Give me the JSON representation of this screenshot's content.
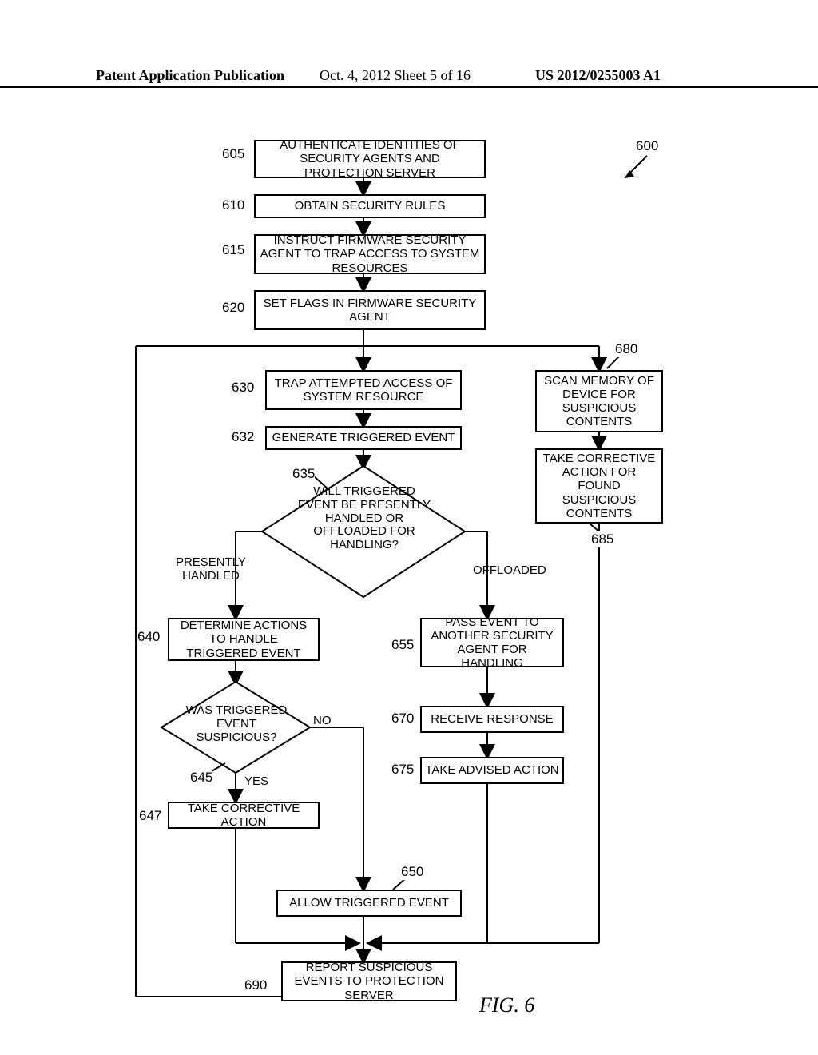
{
  "header": {
    "left": "Patent Application Publication",
    "mid": "Oct. 4, 2012   Sheet 5 of 16",
    "right": "US 2012/0255003 A1"
  },
  "refs": {
    "r600": "600",
    "r605": "605",
    "r610": "610",
    "r615": "615",
    "r620": "620",
    "r630": "630",
    "r632": "632",
    "r635": "635",
    "r640": "640",
    "r645": "645",
    "r647": "647",
    "r650": "650",
    "r655": "655",
    "r670": "670",
    "r675": "675",
    "r680": "680",
    "r685": "685",
    "r690": "690"
  },
  "boxes": {
    "b605": "AUTHENTICATE IDENTITIES OF SECURITY AGENTS AND PROTECTION SERVER",
    "b610": "OBTAIN SECURITY RULES",
    "b615": "INSTRUCT FIRMWARE SECURITY AGENT TO TRAP ACCESS TO SYSTEM RESOURCES",
    "b620": "SET FLAGS IN FIRMWARE SECURITY AGENT",
    "b630": "TRAP ATTEMPTED ACCESS OF SYSTEM RESOURCE",
    "b632": "GENERATE TRIGGERED EVENT",
    "b640": "DETERMINE ACTIONS TO HANDLE TRIGGERED EVENT",
    "b647": "TAKE CORRECTIVE ACTION",
    "b650": "ALLOW TRIGGERED EVENT",
    "b655": "PASS EVENT TO ANOTHER SECURITY AGENT FOR HANDLING",
    "b670": "RECEIVE RESPONSE",
    "b675": "TAKE ADVISED ACTION",
    "b680": "SCAN MEMORY OF DEVICE FOR SUSPICIOUS CONTENTS",
    "b685": "TAKE CORRECTIVE ACTION FOR FOUND SUSPICIOUS CONTENTS",
    "b690": "REPORT SUSPICIOUS EVENTS TO PROTECTION SERVER"
  },
  "diamonds": {
    "d635": "WILL TRIGGERED EVENT BE PRESENTLY HANDLED OR OFFLOADED FOR HANDLING?",
    "d645": "WAS TRIGGERED EVENT SUSPICIOUS?"
  },
  "branch_labels": {
    "presently": "PRESENTLY HANDLED",
    "offloaded": "OFFLOADED",
    "no": "NO",
    "yes": "YES"
  },
  "figure_label": "FIG. 6",
  "chart_data": {
    "type": "flowchart",
    "title": "FIG. 6",
    "ref": "600",
    "nodes": [
      {
        "id": "605",
        "type": "process",
        "text": "AUTHENTICATE IDENTITIES OF SECURITY AGENTS AND PROTECTION SERVER"
      },
      {
        "id": "610",
        "type": "process",
        "text": "OBTAIN SECURITY RULES"
      },
      {
        "id": "615",
        "type": "process",
        "text": "INSTRUCT FIRMWARE SECURITY AGENT TO TRAP ACCESS TO SYSTEM RESOURCES"
      },
      {
        "id": "620",
        "type": "process",
        "text": "SET FLAGS IN FIRMWARE SECURITY AGENT"
      },
      {
        "id": "630",
        "type": "process",
        "text": "TRAP ATTEMPTED ACCESS OF SYSTEM RESOURCE"
      },
      {
        "id": "632",
        "type": "process",
        "text": "GENERATE TRIGGERED EVENT"
      },
      {
        "id": "635",
        "type": "decision",
        "text": "WILL TRIGGERED EVENT BE PRESENTLY HANDLED OR OFFLOADED FOR HANDLING?"
      },
      {
        "id": "640",
        "type": "process",
        "text": "DETERMINE ACTIONS TO HANDLE TRIGGERED EVENT"
      },
      {
        "id": "645",
        "type": "decision",
        "text": "WAS TRIGGERED EVENT SUSPICIOUS?"
      },
      {
        "id": "647",
        "type": "process",
        "text": "TAKE CORRECTIVE ACTION"
      },
      {
        "id": "650",
        "type": "process",
        "text": "ALLOW TRIGGERED EVENT"
      },
      {
        "id": "655",
        "type": "process",
        "text": "PASS EVENT TO ANOTHER SECURITY AGENT FOR HANDLING"
      },
      {
        "id": "670",
        "type": "process",
        "text": "RECEIVE RESPONSE"
      },
      {
        "id": "675",
        "type": "process",
        "text": "TAKE ADVISED ACTION"
      },
      {
        "id": "680",
        "type": "process",
        "text": "SCAN MEMORY OF DEVICE FOR SUSPICIOUS CONTENTS"
      },
      {
        "id": "685",
        "type": "process",
        "text": "TAKE CORRECTIVE ACTION FOR FOUND SUSPICIOUS CONTENTS"
      },
      {
        "id": "690",
        "type": "process",
        "text": "REPORT SUSPICIOUS EVENTS TO PROTECTION SERVER"
      }
    ],
    "edges": [
      {
        "from": "605",
        "to": "610"
      },
      {
        "from": "610",
        "to": "615"
      },
      {
        "from": "615",
        "to": "620"
      },
      {
        "from": "620",
        "to": "630"
      },
      {
        "from": "620",
        "to": "680"
      },
      {
        "from": "630",
        "to": "632"
      },
      {
        "from": "632",
        "to": "635"
      },
      {
        "from": "635",
        "to": "640",
        "label": "PRESENTLY HANDLED"
      },
      {
        "from": "635",
        "to": "655",
        "label": "OFFLOADED"
      },
      {
        "from": "640",
        "to": "645"
      },
      {
        "from": "645",
        "to": "647",
        "label": "YES"
      },
      {
        "from": "645",
        "to": "650",
        "label": "NO"
      },
      {
        "from": "647",
        "to": "690"
      },
      {
        "from": "650",
        "to": "690"
      },
      {
        "from": "655",
        "to": "670"
      },
      {
        "from": "670",
        "to": "675"
      },
      {
        "from": "675",
        "to": "690"
      },
      {
        "from": "680",
        "to": "685"
      },
      {
        "from": "685",
        "to": "690"
      },
      {
        "from": "690",
        "to": "630",
        "note": "loop back"
      }
    ]
  }
}
